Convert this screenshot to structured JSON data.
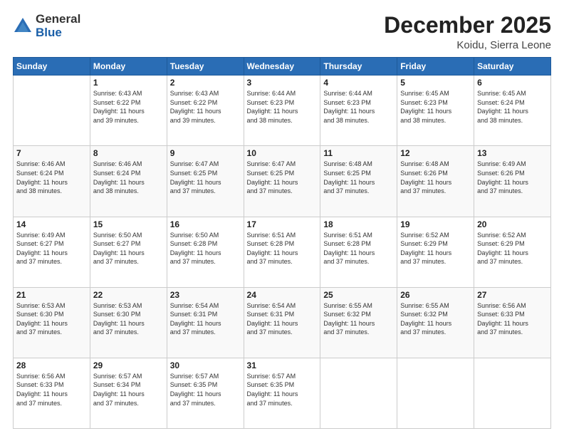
{
  "logo": {
    "general": "General",
    "blue": "Blue"
  },
  "title": "December 2025",
  "location": "Koidu, Sierra Leone",
  "days_of_week": [
    "Sunday",
    "Monday",
    "Tuesday",
    "Wednesday",
    "Thursday",
    "Friday",
    "Saturday"
  ],
  "weeks": [
    [
      {
        "day": "",
        "content": ""
      },
      {
        "day": "1",
        "content": "Sunrise: 6:43 AM\nSunset: 6:22 PM\nDaylight: 11 hours\nand 39 minutes."
      },
      {
        "day": "2",
        "content": "Sunrise: 6:43 AM\nSunset: 6:22 PM\nDaylight: 11 hours\nand 39 minutes."
      },
      {
        "day": "3",
        "content": "Sunrise: 6:44 AM\nSunset: 6:23 PM\nDaylight: 11 hours\nand 38 minutes."
      },
      {
        "day": "4",
        "content": "Sunrise: 6:44 AM\nSunset: 6:23 PM\nDaylight: 11 hours\nand 38 minutes."
      },
      {
        "day": "5",
        "content": "Sunrise: 6:45 AM\nSunset: 6:23 PM\nDaylight: 11 hours\nand 38 minutes."
      },
      {
        "day": "6",
        "content": "Sunrise: 6:45 AM\nSunset: 6:24 PM\nDaylight: 11 hours\nand 38 minutes."
      }
    ],
    [
      {
        "day": "7",
        "content": "Sunrise: 6:46 AM\nSunset: 6:24 PM\nDaylight: 11 hours\nand 38 minutes."
      },
      {
        "day": "8",
        "content": "Sunrise: 6:46 AM\nSunset: 6:24 PM\nDaylight: 11 hours\nand 38 minutes."
      },
      {
        "day": "9",
        "content": "Sunrise: 6:47 AM\nSunset: 6:25 PM\nDaylight: 11 hours\nand 37 minutes."
      },
      {
        "day": "10",
        "content": "Sunrise: 6:47 AM\nSunset: 6:25 PM\nDaylight: 11 hours\nand 37 minutes."
      },
      {
        "day": "11",
        "content": "Sunrise: 6:48 AM\nSunset: 6:25 PM\nDaylight: 11 hours\nand 37 minutes."
      },
      {
        "day": "12",
        "content": "Sunrise: 6:48 AM\nSunset: 6:26 PM\nDaylight: 11 hours\nand 37 minutes."
      },
      {
        "day": "13",
        "content": "Sunrise: 6:49 AM\nSunset: 6:26 PM\nDaylight: 11 hours\nand 37 minutes."
      }
    ],
    [
      {
        "day": "14",
        "content": "Sunrise: 6:49 AM\nSunset: 6:27 PM\nDaylight: 11 hours\nand 37 minutes."
      },
      {
        "day": "15",
        "content": "Sunrise: 6:50 AM\nSunset: 6:27 PM\nDaylight: 11 hours\nand 37 minutes."
      },
      {
        "day": "16",
        "content": "Sunrise: 6:50 AM\nSunset: 6:28 PM\nDaylight: 11 hours\nand 37 minutes."
      },
      {
        "day": "17",
        "content": "Sunrise: 6:51 AM\nSunset: 6:28 PM\nDaylight: 11 hours\nand 37 minutes."
      },
      {
        "day": "18",
        "content": "Sunrise: 6:51 AM\nSunset: 6:28 PM\nDaylight: 11 hours\nand 37 minutes."
      },
      {
        "day": "19",
        "content": "Sunrise: 6:52 AM\nSunset: 6:29 PM\nDaylight: 11 hours\nand 37 minutes."
      },
      {
        "day": "20",
        "content": "Sunrise: 6:52 AM\nSunset: 6:29 PM\nDaylight: 11 hours\nand 37 minutes."
      }
    ],
    [
      {
        "day": "21",
        "content": "Sunrise: 6:53 AM\nSunset: 6:30 PM\nDaylight: 11 hours\nand 37 minutes."
      },
      {
        "day": "22",
        "content": "Sunrise: 6:53 AM\nSunset: 6:30 PM\nDaylight: 11 hours\nand 37 minutes."
      },
      {
        "day": "23",
        "content": "Sunrise: 6:54 AM\nSunset: 6:31 PM\nDaylight: 11 hours\nand 37 minutes."
      },
      {
        "day": "24",
        "content": "Sunrise: 6:54 AM\nSunset: 6:31 PM\nDaylight: 11 hours\nand 37 minutes."
      },
      {
        "day": "25",
        "content": "Sunrise: 6:55 AM\nSunset: 6:32 PM\nDaylight: 11 hours\nand 37 minutes."
      },
      {
        "day": "26",
        "content": "Sunrise: 6:55 AM\nSunset: 6:32 PM\nDaylight: 11 hours\nand 37 minutes."
      },
      {
        "day": "27",
        "content": "Sunrise: 6:56 AM\nSunset: 6:33 PM\nDaylight: 11 hours\nand 37 minutes."
      }
    ],
    [
      {
        "day": "28",
        "content": "Sunrise: 6:56 AM\nSunset: 6:33 PM\nDaylight: 11 hours\nand 37 minutes."
      },
      {
        "day": "29",
        "content": "Sunrise: 6:57 AM\nSunset: 6:34 PM\nDaylight: 11 hours\nand 37 minutes."
      },
      {
        "day": "30",
        "content": "Sunrise: 6:57 AM\nSunset: 6:35 PM\nDaylight: 11 hours\nand 37 minutes."
      },
      {
        "day": "31",
        "content": "Sunrise: 6:57 AM\nSunset: 6:35 PM\nDaylight: 11 hours\nand 37 minutes."
      },
      {
        "day": "",
        "content": ""
      },
      {
        "day": "",
        "content": ""
      },
      {
        "day": "",
        "content": ""
      }
    ]
  ]
}
